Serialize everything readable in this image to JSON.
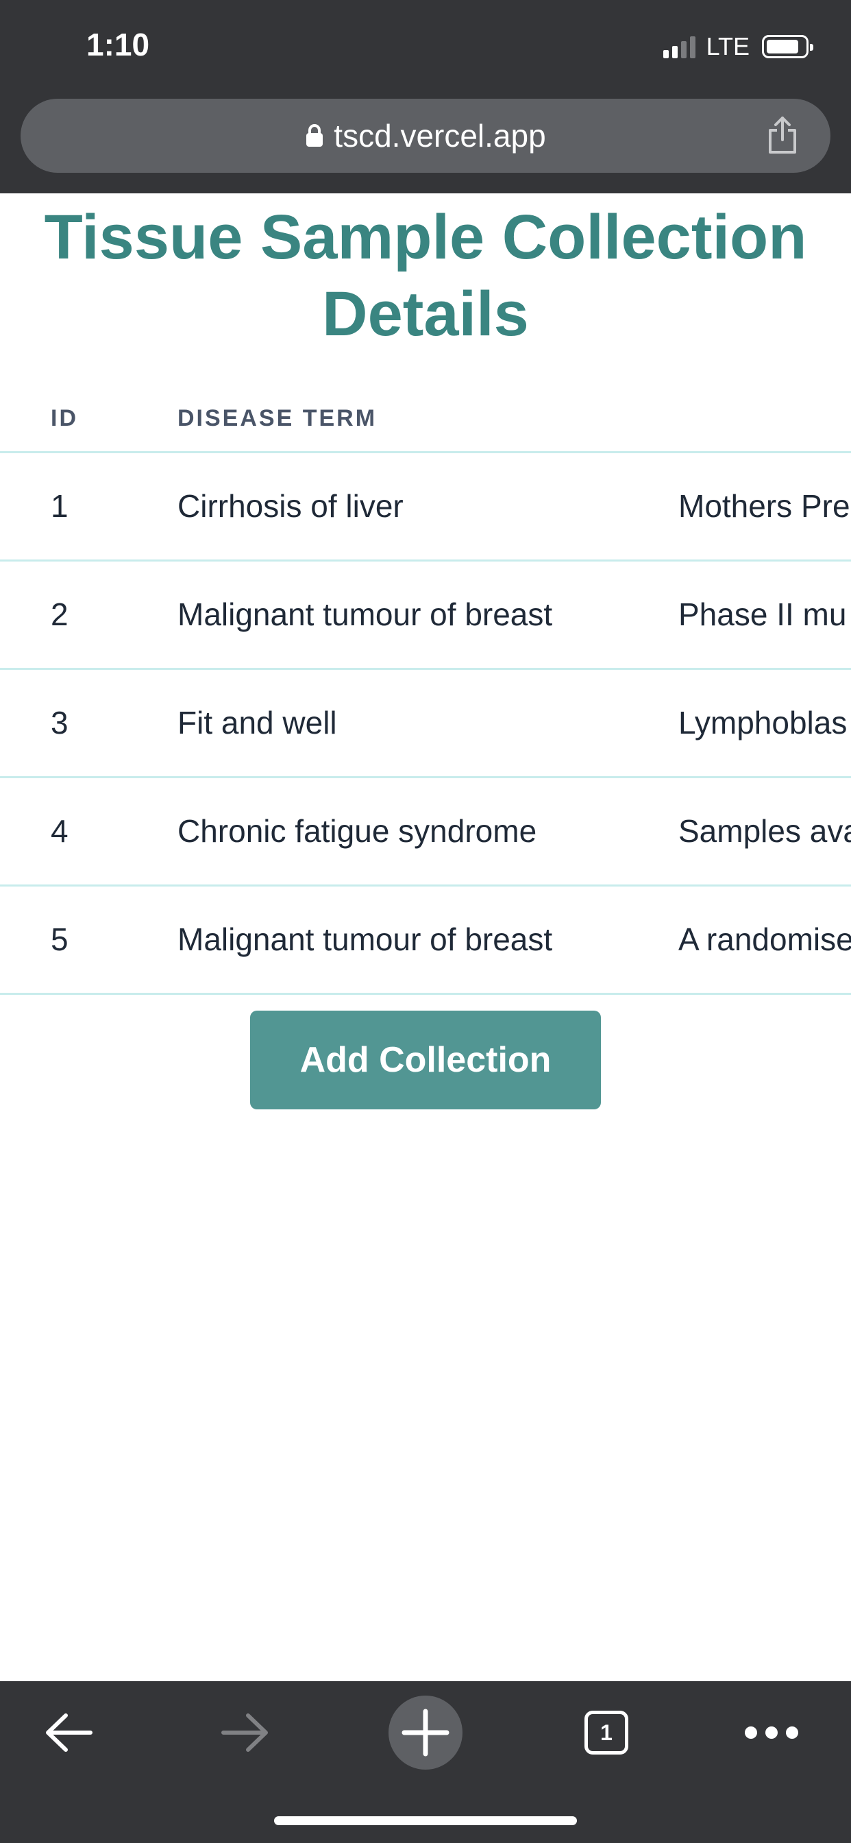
{
  "status_bar": {
    "time": "1:10",
    "network": "LTE",
    "signal_bars_active": 2,
    "signal_bars_total": 4
  },
  "browser": {
    "url": "tscd.vercel.app",
    "tab_count": "1",
    "icons": {
      "lock": "lock-icon",
      "share": "share-icon",
      "back": "back-arrow-icon",
      "forward": "forward-arrow-icon",
      "new_tab": "plus-icon",
      "tabs": "tabs-icon",
      "more": "more-icon"
    }
  },
  "page": {
    "title": "Tissue Sample Collection Details",
    "table": {
      "headers": [
        "ID",
        "DISEASE TERM"
      ],
      "rows": [
        {
          "id": "1",
          "disease_term": "Cirrhosis of liver",
          "description": "Mothers Pre"
        },
        {
          "id": "2",
          "disease_term": "Malignant tumour of breast",
          "description": "Phase II mu"
        },
        {
          "id": "3",
          "disease_term": "Fit and well",
          "description": "Lymphoblas"
        },
        {
          "id": "4",
          "disease_term": "Chronic fatigue syndrome",
          "description": "Samples ava"
        },
        {
          "id": "5",
          "disease_term": "Malignant tumour of breast",
          "description": "A randomise"
        }
      ]
    },
    "add_button_label": "Add Collection"
  },
  "colors": {
    "accent": "#3a8581",
    "button": "#529693",
    "row_border": "#c8ecec",
    "chrome": "#343538"
  }
}
